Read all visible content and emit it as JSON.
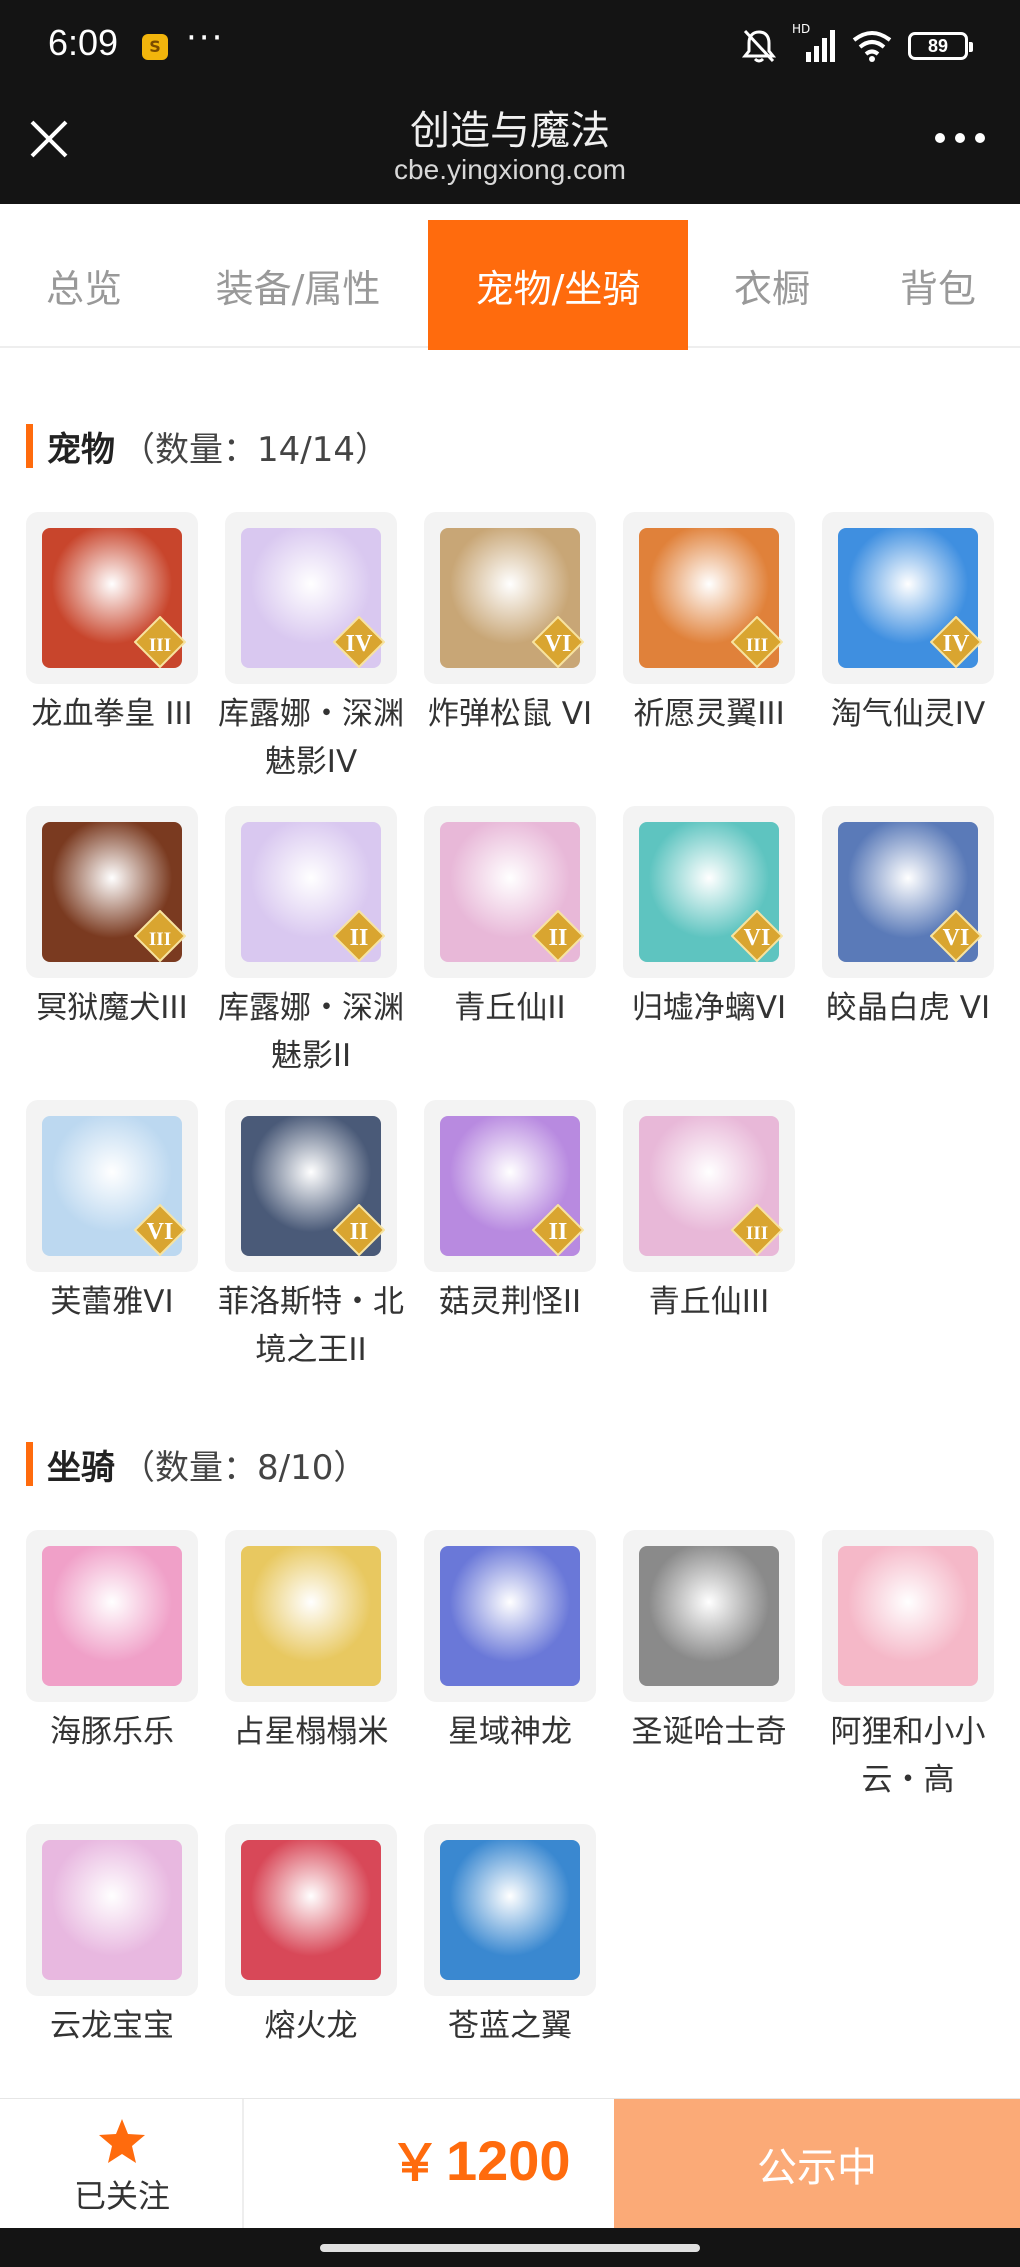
{
  "status_bar": {
    "time": "6:09",
    "app_icon": "S",
    "more": "···",
    "hd": "HD",
    "battery": "89"
  },
  "header": {
    "title": "创造与魔法",
    "domain": "cbe.yingxiong.com"
  },
  "tabs": [
    {
      "label": "总览",
      "active": false
    },
    {
      "label": "装备/属性",
      "active": false
    },
    {
      "label": "宠物/坐骑",
      "active": true
    },
    {
      "label": "衣橱",
      "active": false
    },
    {
      "label": "背包",
      "active": false
    }
  ],
  "pets": {
    "title": "宠物",
    "count": "（数量：14/14）",
    "items": [
      {
        "name": "龙血拳皇 III",
        "tier": "III",
        "color": "#c8452c"
      },
      {
        "name": "库露娜・深渊魅影IV",
        "tier": "IV",
        "color": "#d9c8f0"
      },
      {
        "name": "炸弹松鼠 VI",
        "tier": "VI",
        "color": "#c8a676"
      },
      {
        "name": "祈愿灵翼III",
        "tier": "III",
        "color": "#e0813a"
      },
      {
        "name": "淘气仙灵IV",
        "tier": "IV",
        "color": "#3f8fe0"
      },
      {
        "name": "冥狱魔犬III",
        "tier": "III",
        "color": "#7a3a20"
      },
      {
        "name": "库露娜・深渊魅影II",
        "tier": "II",
        "color": "#d9c8f0"
      },
      {
        "name": "青丘仙II",
        "tier": "II",
        "color": "#e8b8d8"
      },
      {
        "name": "归墟净螭VI",
        "tier": "VI",
        "color": "#5ec4c0"
      },
      {
        "name": "皎晶白虎 VI",
        "tier": "VI",
        "color": "#5a7ab8"
      },
      {
        "name": "芙蕾雅VI",
        "tier": "VI",
        "color": "#bcd8f0"
      },
      {
        "name": "菲洛斯特・北境之王II",
        "tier": "II",
        "color": "#4a5a78"
      },
      {
        "name": "菇灵荆怪II",
        "tier": "II",
        "color": "#b88ae0"
      },
      {
        "name": "青丘仙III",
        "tier": "III",
        "color": "#e8b8d8"
      }
    ]
  },
  "mounts": {
    "title": "坐骑",
    "count": "（数量：8/10）",
    "items": [
      {
        "name": "海豚乐乐",
        "color": "#f0a0c8"
      },
      {
        "name": "占星榻榻米",
        "color": "#e8c860"
      },
      {
        "name": "星域神龙",
        "color": "#6a78d8"
      },
      {
        "name": "圣诞哈士奇",
        "color": "#8a8a8a"
      },
      {
        "name": "阿狸和小小云・高",
        "color": "#f5b8c8"
      },
      {
        "name": "云龙宝宝",
        "color": "#e8b8e0"
      },
      {
        "name": "熔火龙",
        "color": "#d84858"
      },
      {
        "name": "苍蓝之翼",
        "color": "#3a88d0"
      }
    ]
  },
  "bottom": {
    "follow_label": "已关注",
    "currency": "￥",
    "price": "1200",
    "status_button": "公示中"
  }
}
